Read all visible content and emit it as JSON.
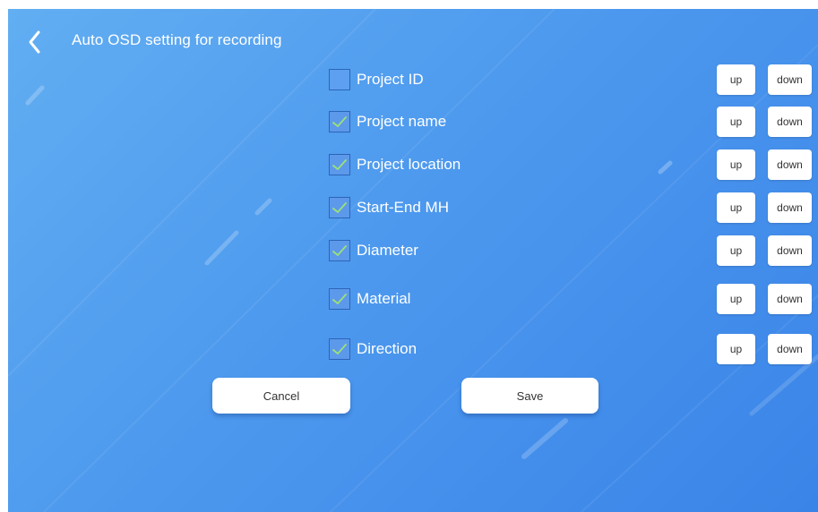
{
  "header": {
    "title": "Auto OSD setting for recording",
    "back_icon": "chevron-left-icon"
  },
  "options": [
    {
      "label": "Project ID",
      "checked": false,
      "up_label": "up",
      "down_label": "down"
    },
    {
      "label": "Project name",
      "checked": true,
      "up_label": "up",
      "down_label": "down"
    },
    {
      "label": "Project location",
      "checked": true,
      "up_label": "up",
      "down_label": "down"
    },
    {
      "label": "Start-End MH",
      "checked": true,
      "up_label": "up",
      "down_label": "down"
    },
    {
      "label": "Diameter",
      "checked": true,
      "up_label": "up",
      "down_label": "down"
    },
    {
      "label": "Material",
      "checked": true,
      "up_label": "up",
      "down_label": "down"
    },
    {
      "label": "Direction",
      "checked": true,
      "up_label": "up",
      "down_label": "down"
    }
  ],
  "footer": {
    "cancel_label": "Cancel",
    "save_label": "Save"
  },
  "colors": {
    "background": "#4d99ee",
    "check_mark": "#9de07a",
    "text": "#ffffff",
    "button_bg": "#ffffff"
  }
}
